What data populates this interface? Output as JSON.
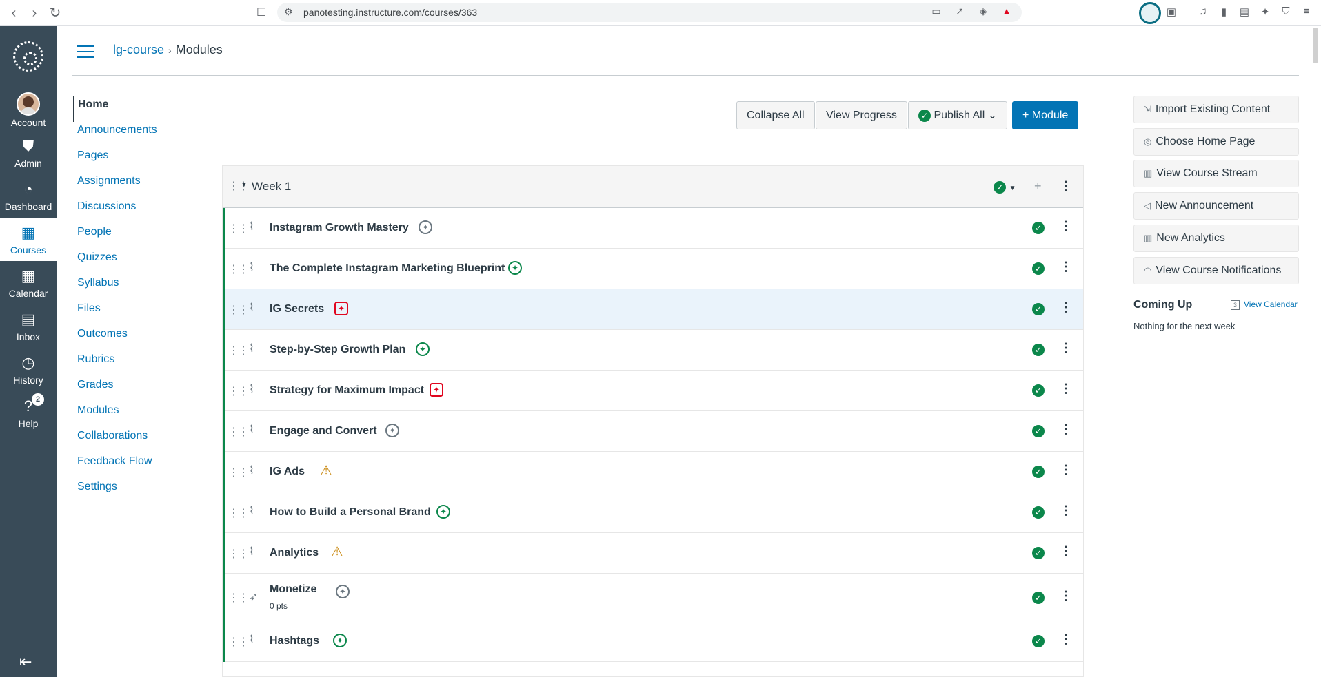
{
  "browser": {
    "url": "panotesting.instructure.com/courses/363"
  },
  "global_nav": {
    "items": [
      {
        "label": "Account",
        "icon": "avatar"
      },
      {
        "label": "Admin",
        "icon": "shield-icon"
      },
      {
        "label": "Dashboard",
        "icon": "gauge-icon"
      },
      {
        "label": "Courses",
        "icon": "book-icon"
      },
      {
        "label": "Calendar",
        "icon": "calendar-icon"
      },
      {
        "label": "Inbox",
        "icon": "inbox-icon"
      },
      {
        "label": "History",
        "icon": "clock-icon"
      },
      {
        "label": "Help",
        "icon": "help-icon",
        "badge": "2"
      }
    ]
  },
  "breadcrumb": {
    "course": "lg-course",
    "separator": "›",
    "current": "Modules"
  },
  "course_nav": [
    "Home",
    "Announcements",
    "Pages",
    "Assignments",
    "Discussions",
    "People",
    "Quizzes",
    "Syllabus",
    "Files",
    "Outcomes",
    "Rubrics",
    "Grades",
    "Modules",
    "Collaborations",
    "Feedback Flow",
    "Settings"
  ],
  "toolbar": {
    "collapse_all": "Collapse All",
    "view_progress": "View Progress",
    "publish_all": "Publish All",
    "add_module": "+ Module"
  },
  "module": {
    "title": "Week 1",
    "items": [
      {
        "title": "Instagram Growth Mastery",
        "type": "attachment",
        "a11y": "gray"
      },
      {
        "title": "The Complete Instagram Marketing Blueprint",
        "type": "attachment",
        "a11y": "green"
      },
      {
        "title": "IG Secrets",
        "type": "attachment",
        "a11y": "red"
      },
      {
        "title": "Step-by-Step Growth Plan",
        "type": "attachment",
        "a11y": "green"
      },
      {
        "title": "Strategy for Maximum Impact",
        "type": "attachment",
        "a11y": "red"
      },
      {
        "title": "Engage and Convert",
        "type": "attachment",
        "a11y": "gray"
      },
      {
        "title": "IG Ads",
        "type": "attachment",
        "a11y": "warn"
      },
      {
        "title": "How to Build a Personal Brand",
        "type": "attachment",
        "a11y": "green"
      },
      {
        "title": "Analytics",
        "type": "attachment",
        "a11y": "warn"
      },
      {
        "title": "Monetize",
        "subtitle": "0 pts",
        "type": "quiz",
        "a11y": "gray"
      },
      {
        "title": "Hashtags",
        "type": "attachment",
        "a11y": "green-hex"
      }
    ]
  },
  "sidebar": {
    "buttons": [
      "Import Existing Content",
      "Choose Home Page",
      "View Course Stream",
      "New Announcement",
      "New Analytics",
      "View Course Notifications"
    ],
    "coming_up": "Coming Up",
    "view_calendar": "View Calendar",
    "calendar_day": "3",
    "nothing": "Nothing for the next week"
  },
  "colors": {
    "brand": "#0374b5",
    "nav_bg": "#394b58",
    "published": "#0b874b",
    "error": "#e0061f",
    "warning": "#c8860b"
  }
}
